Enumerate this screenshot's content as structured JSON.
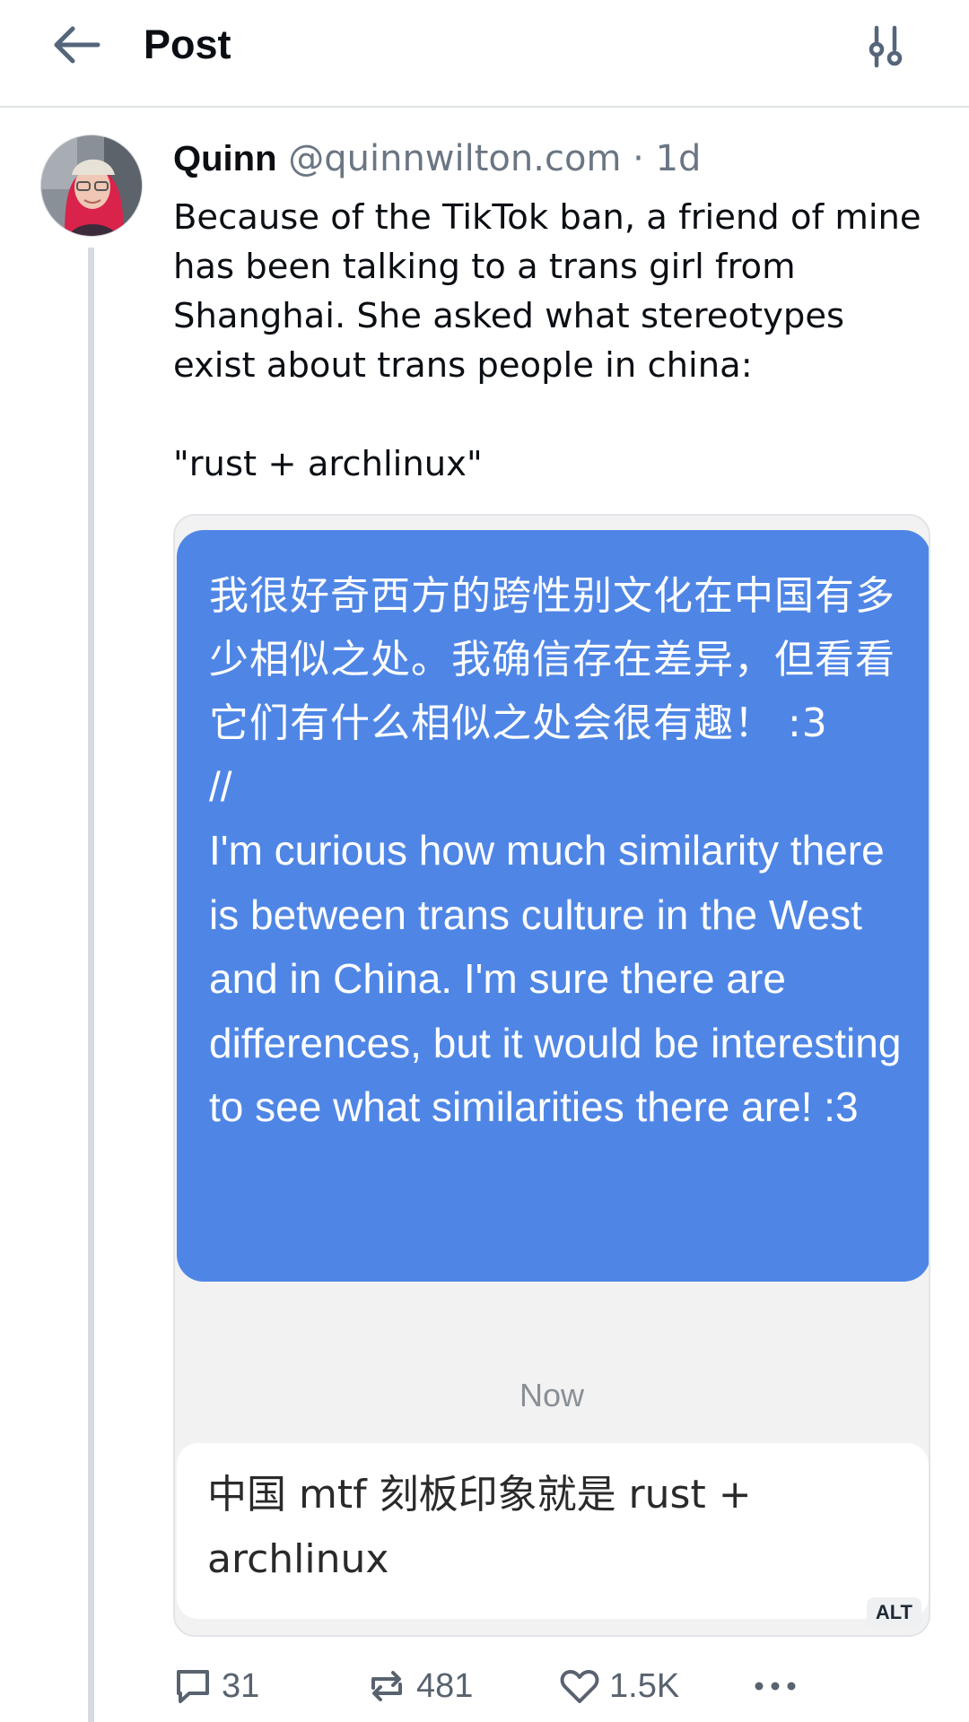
{
  "header": {
    "title": "Post"
  },
  "post": {
    "author_name": "Quinn",
    "author_handle": "@quinnwilton.com",
    "separator": "·",
    "time": "1d",
    "paragraphs": [
      "Because of the TikTok ban, a friend of mine has been talking to a trans girl from Shanghai. She asked what stereotypes exist about trans people in china:",
      "\"rust + archlinux\""
    ]
  },
  "image": {
    "message_cn": "我很好奇西方的跨性别文化在中国有多少相似之处。我确信存在差异，但看看它们有什么相似之处会很有趣！ :3",
    "message_sep": "//",
    "message_en": "I'm curious how much similarity there is between trans culture in the West and in China. I'm sure there are differences, but it would be interesting to see what similarities there are! :3",
    "timestamp": "Now",
    "reply": "中国 mtf 刻板印象就是 rust + archlinux",
    "alt_badge": "ALT"
  },
  "actions": {
    "replies": "31",
    "reposts": "481",
    "likes": "1.5K"
  },
  "colors": {
    "bubble_blue": "#4f86e6",
    "text_secondary": "#6b7683",
    "icon": "#59636f"
  }
}
